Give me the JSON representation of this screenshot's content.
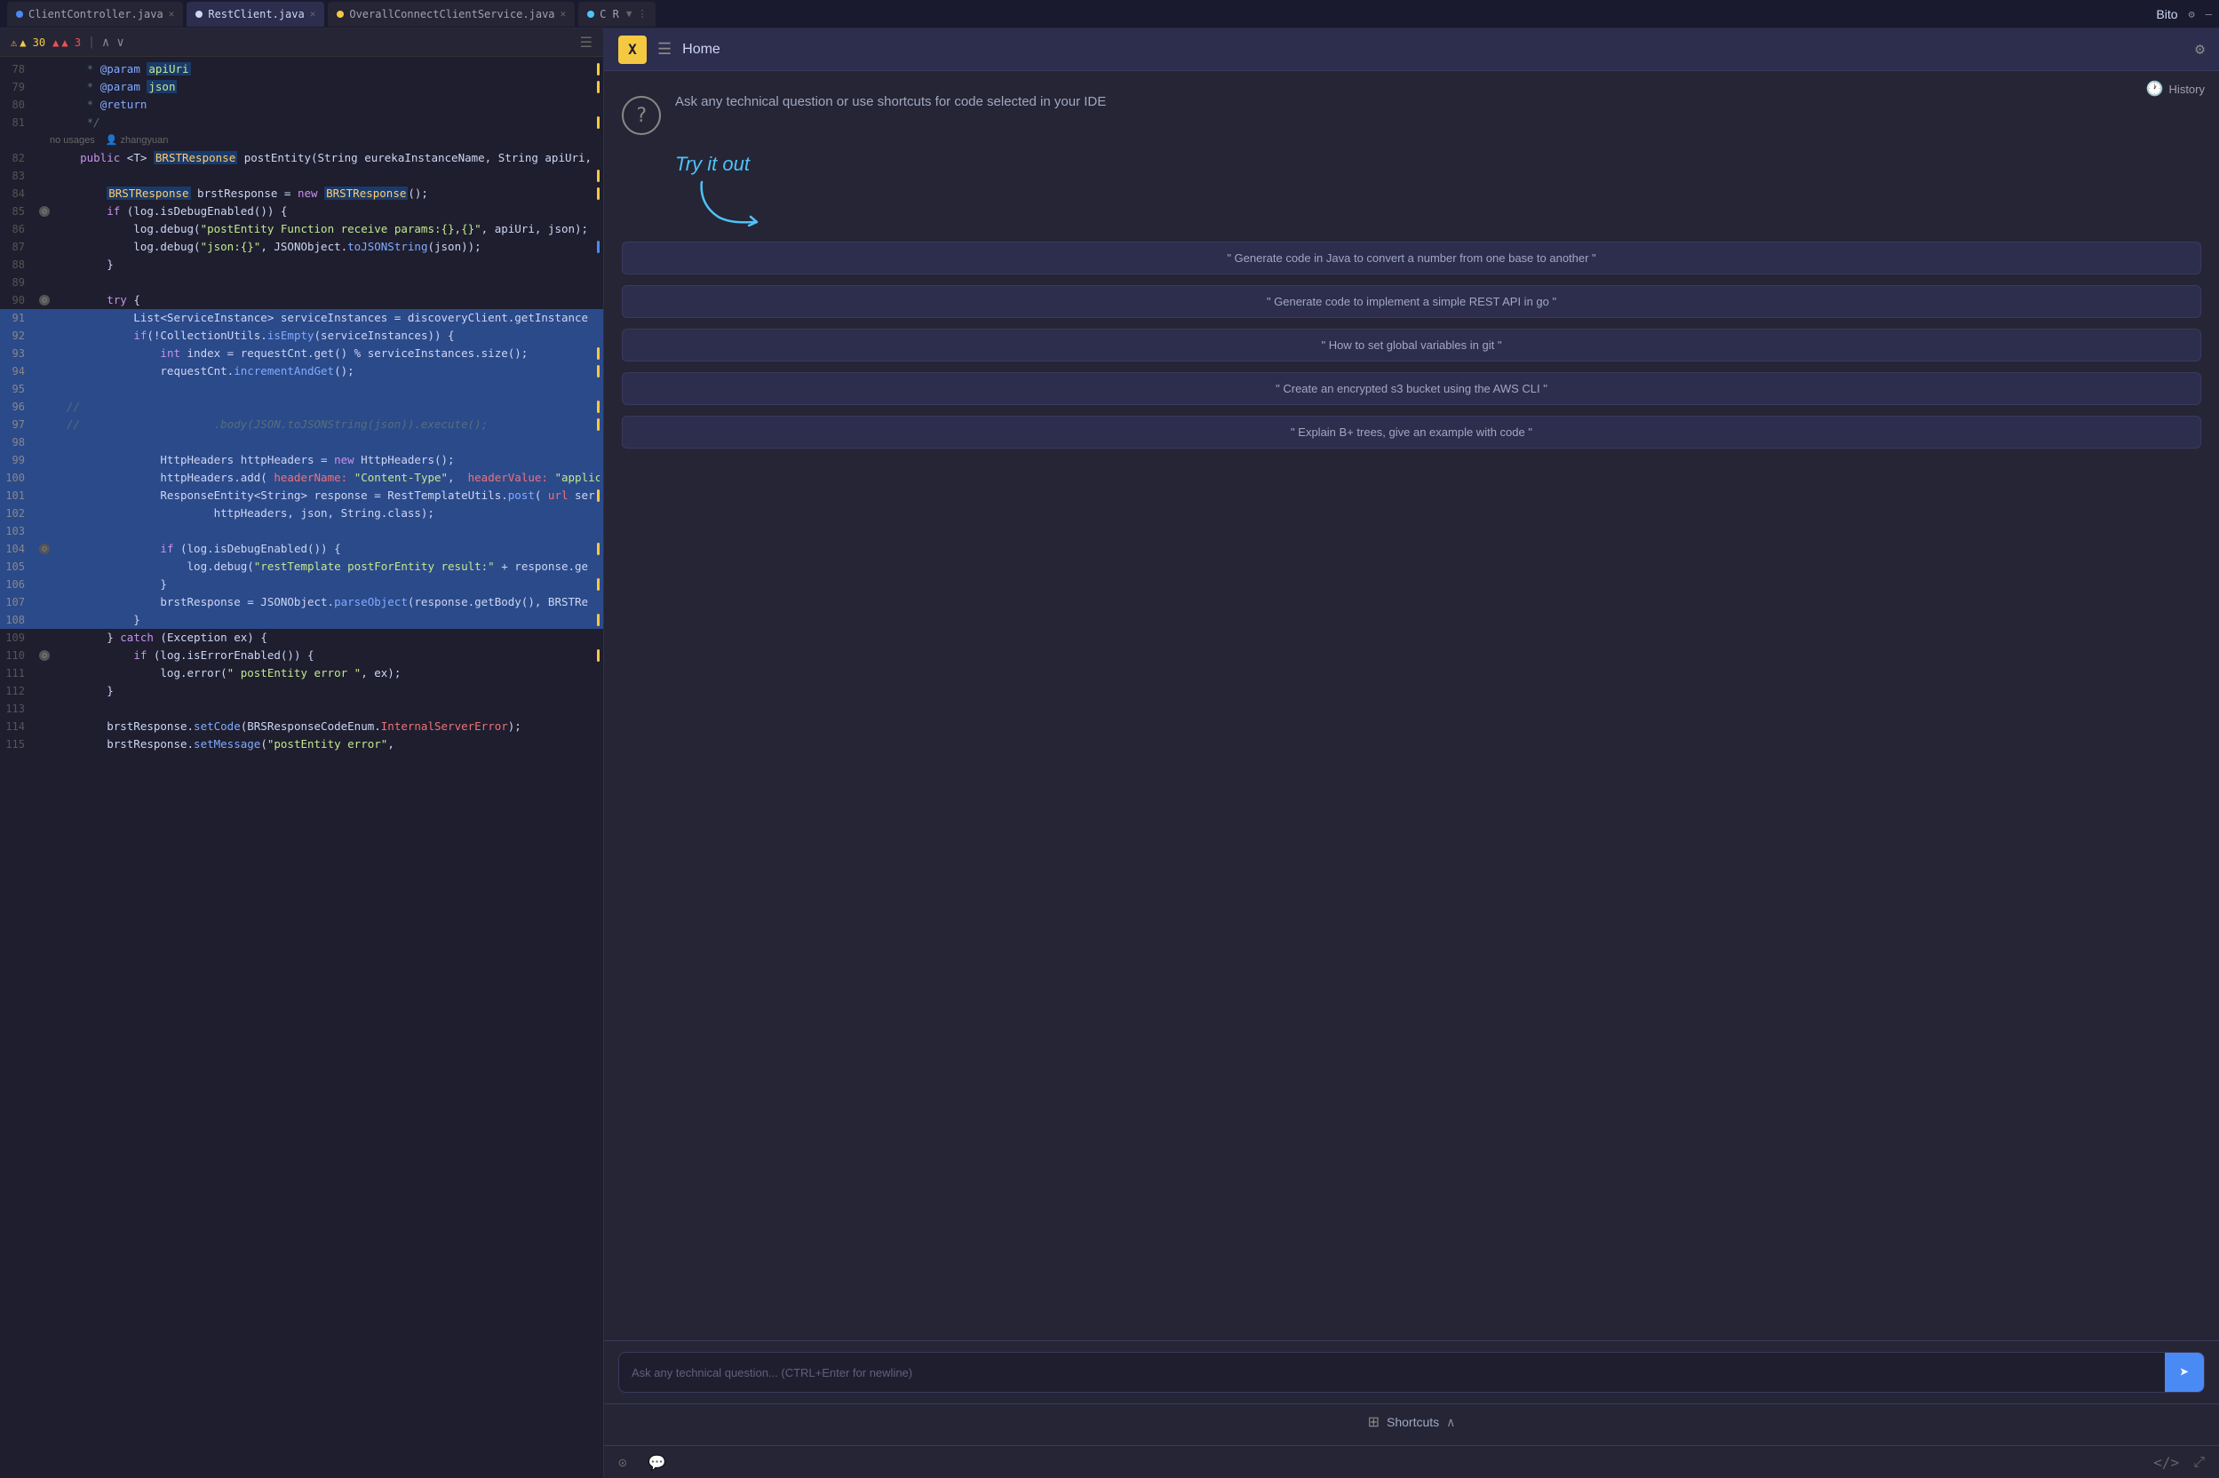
{
  "titlebar": {
    "tabs": [
      {
        "label": "ClientController.java",
        "color": "#4a8af5",
        "active": false,
        "dot_color": "#4a8af5"
      },
      {
        "label": "RestClient.java",
        "color": "#cdd6f4",
        "active": true,
        "dot_color": "#cdd6f4"
      },
      {
        "label": "OverallConnectClientService.java",
        "color": "#f5c842",
        "active": false,
        "dot_color": "#f5c842"
      },
      {
        "label": "C R",
        "color": "#4fc3f7",
        "active": false,
        "dot_color": "#4fc3f7"
      }
    ],
    "app_title": "Bito",
    "settings_icon": "⚙",
    "minimize_icon": "—"
  },
  "editor": {
    "warnings": "▲ 30",
    "errors": "▲ 3",
    "lines": [
      {
        "num": "78",
        "content": "     * @param apiUri",
        "selected": false,
        "type": "comment"
      },
      {
        "num": "79",
        "content": "     * @param json",
        "selected": false,
        "type": "comment"
      },
      {
        "num": "80",
        "content": "     * @return",
        "selected": false,
        "type": "comment"
      },
      {
        "num": "81",
        "content": "     */",
        "selected": false,
        "type": "comment"
      },
      {
        "num": "",
        "content": "no usages  👤 zhangyuan",
        "selected": false,
        "type": "meta"
      },
      {
        "num": "82",
        "content": "    public <T> BRSTResponse postEntity(String eurekaInstanceName, String apiUri,",
        "selected": false,
        "type": "code"
      },
      {
        "num": "83",
        "content": "",
        "selected": false,
        "type": "blank"
      },
      {
        "num": "84",
        "content": "        BRSTResponse brstResponse = new BRSTResponse();",
        "selected": false,
        "type": "code"
      },
      {
        "num": "85",
        "content": "        if (log.isDebugEnabled()) {",
        "selected": false,
        "type": "code"
      },
      {
        "num": "86",
        "content": "            log.debug(\"postEntity Function receive params:{},{}\", apiUri, json);",
        "selected": false,
        "type": "code"
      },
      {
        "num": "87",
        "content": "            log.debug(\"json:{}\", JSONObject.toJSONString(json));",
        "selected": false,
        "type": "code"
      },
      {
        "num": "88",
        "content": "        }",
        "selected": false,
        "type": "code"
      },
      {
        "num": "89",
        "content": "",
        "selected": false,
        "type": "blank"
      },
      {
        "num": "90",
        "content": "        try {",
        "selected": false,
        "type": "code"
      },
      {
        "num": "91",
        "content": "            List<ServiceInstance> serviceInstances = discoveryClient.getInstance",
        "selected": true,
        "type": "code"
      },
      {
        "num": "92",
        "content": "            if(!CollectionUtils.isEmpty(serviceInstances)) {",
        "selected": true,
        "type": "code"
      },
      {
        "num": "93",
        "content": "                int index = requestCnt.get() % serviceInstances.size();",
        "selected": true,
        "type": "code"
      },
      {
        "num": "94",
        "content": "                requestCnt.incrementAndGet();",
        "selected": true,
        "type": "code"
      },
      {
        "num": "95",
        "content": "",
        "selected": true,
        "type": "blank"
      },
      {
        "num": "96",
        "content": "  //",
        "selected": true,
        "type": "code"
      },
      {
        "num": "97",
        "content": "  //                    .body(JSON.toJSONString(json)).execute();",
        "selected": true,
        "type": "code"
      },
      {
        "num": "98",
        "content": "",
        "selected": true,
        "type": "blank"
      },
      {
        "num": "99",
        "content": "                HttpHeaders httpHeaders = new HttpHeaders();",
        "selected": true,
        "type": "code"
      },
      {
        "num": "100",
        "content": "                httpHeaders.add( headerName: \"Content-Type\",  headerValue: \"applica",
        "selected": true,
        "type": "code"
      },
      {
        "num": "101",
        "content": "                ResponseEntity<String> response = RestTemplateUtils.post( url ser",
        "selected": true,
        "type": "code"
      },
      {
        "num": "102",
        "content": "                        httpHeaders, json, String.class);",
        "selected": true,
        "type": "code"
      },
      {
        "num": "103",
        "content": "",
        "selected": true,
        "type": "blank"
      },
      {
        "num": "104",
        "content": "                if (log.isDebugEnabled()) {",
        "selected": true,
        "type": "code"
      },
      {
        "num": "105",
        "content": "                    log.debug(\"restTemplate postForEntity result:\" + response.ge",
        "selected": true,
        "type": "code"
      },
      {
        "num": "106",
        "content": "                }",
        "selected": true,
        "type": "code"
      },
      {
        "num": "107",
        "content": "                brstResponse = JSONObject.parseObject(response.getBody(), BRSTRe",
        "selected": true,
        "type": "code"
      },
      {
        "num": "108",
        "content": "            }",
        "selected": true,
        "type": "code"
      },
      {
        "num": "109",
        "content": "        } catch (Exception ex) {",
        "selected": false,
        "type": "code"
      },
      {
        "num": "110",
        "content": "            if (log.isErrorEnabled()) {",
        "selected": false,
        "type": "code"
      },
      {
        "num": "111",
        "content": "                log.error(\" postEntity error \", ex);",
        "selected": false,
        "type": "code"
      },
      {
        "num": "112",
        "content": "        }",
        "selected": false,
        "type": "code"
      },
      {
        "num": "113",
        "content": "",
        "selected": false,
        "type": "blank"
      },
      {
        "num": "114",
        "content": "        brstResponse.setCode(BRSResponseCodeEnum.InternalServerError);",
        "selected": false,
        "type": "code"
      },
      {
        "num": "115",
        "content": "        brstResponse.setMessage(\"postEntity error\",",
        "selected": false,
        "type": "code"
      }
    ]
  },
  "bito": {
    "x_label": "X",
    "home_title": "Home",
    "history_label": "History",
    "welcome_text": "Ask any technical question or use shortcuts for code selected in your IDE",
    "try_it_label": "Try it out",
    "suggestions": [
      "\" Generate code in Java to convert a number from one base to another \"",
      "\" Generate code to implement a simple REST API in go \"",
      "\" How to set global variables in git \"",
      "\" Create an encrypted s3 bucket using the AWS CLI \"",
      "\" Explain B+ trees, give an example with code \""
    ],
    "input_placeholder": "Ask any technical question... (CTRL+Enter for newline)",
    "shortcuts_label": "Shortcuts"
  }
}
